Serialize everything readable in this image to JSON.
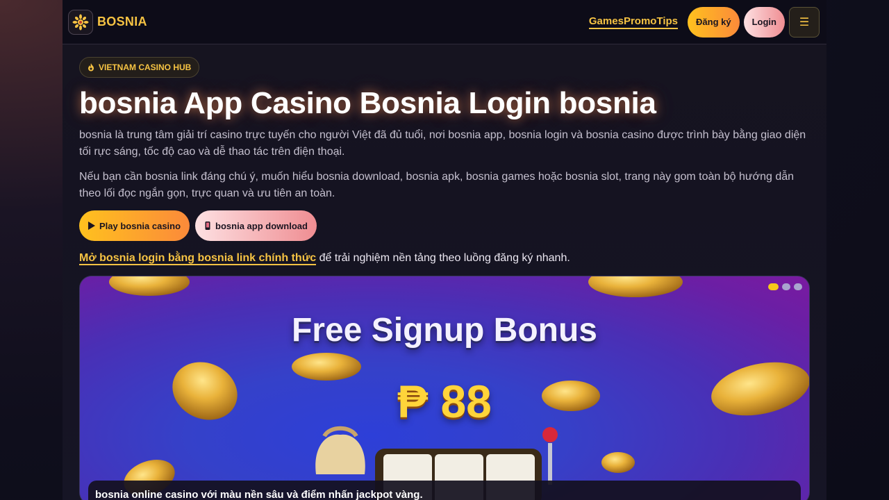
{
  "header": {
    "brand": "BOSNIA",
    "nav": [
      "Games",
      "Promo",
      "Tips"
    ],
    "register_label": "Đăng ký",
    "login_label": "Login",
    "menu_icon": "☰"
  },
  "hero": {
    "badge": "VIETNAM CASINO HUB",
    "title": "bosnia App Casino Bosnia Login bosnia",
    "paragraph1": "bosnia là trung tâm giải trí casino trực tuyến cho người Việt đã đủ tuổi, nơi bosnia app, bosnia login và bosnia casino được trình bày bằng giao diện tối rực sáng, tốc độ cao và dễ thao tác trên điện thoại.",
    "paragraph2": "Nếu bạn cần bosnia link đáng chú ý, muốn hiểu bosnia download, bosnia apk, bosnia games hoặc bosnia slot, trang này gom toàn bộ hướng dẫn theo lối đọc ngắn gọn, trực quan và ưu tiên an toàn.",
    "cta_play": "Play bosnia casino",
    "cta_download": "bosnia app download",
    "login_link": "Mở bosnia login bằng bosnia link chính thức",
    "login_suffix": " để trải nghiệm nền tảng theo luồng đăng ký nhanh."
  },
  "banner": {
    "headline": "Free Signup Bonus",
    "amount": "₱ 88",
    "caption": "bosnia online casino với màu nền sâu và điểm nhấn jackpot vàng.",
    "slides": 3,
    "active_slide": 1
  },
  "colors": {
    "accent_gold": "#f6c343",
    "background": "#151321",
    "gradient_gold": [
      "#ffc11e",
      "#fb8a3a"
    ],
    "gradient_pink": [
      "#fde0e2",
      "#ef8d92"
    ]
  }
}
